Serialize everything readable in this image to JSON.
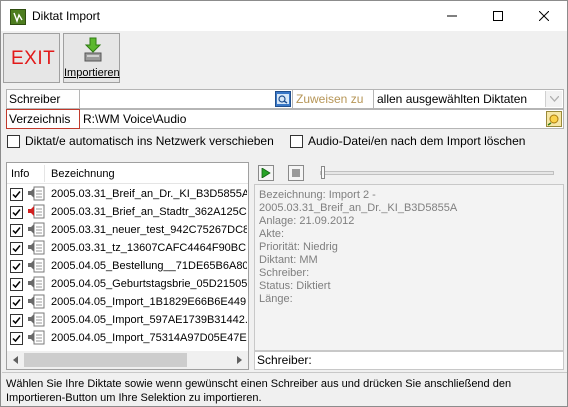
{
  "window": {
    "title": "Diktat Import",
    "icon": "app-logo-icon",
    "controls": [
      "minimize-icon",
      "maximize-icon",
      "close-icon"
    ]
  },
  "toolbar": {
    "exit_label": "EXIT",
    "import_label": "Importieren",
    "import_icon": "import-arrow-icon"
  },
  "form": {
    "schreiber_label": "Schreiber",
    "schreiber_value": "",
    "zuweisen_label": "Zuweisen zu",
    "assign_option": "allen ausgewählten Diktaten",
    "verzeichnis_label": "Verzeichnis",
    "verzeichnis_value": "R:\\WM Voice\\Audio"
  },
  "options": {
    "auto_network_label": "Diktat/e automatisch ins Netzwerk verschieben",
    "delete_audio_label": "Audio-Datei/en nach dem Import löschen"
  },
  "list": {
    "header_info": "Info",
    "header_name": "Bezeichnung",
    "rows": [
      {
        "name": "2005.03.31_Breif_an_Dr._KI_B3D5855A...",
        "checked": true,
        "icon": "document-speaker-icon"
      },
      {
        "name": "2005.03.31_Brief_an_Stadtr_362A125C...",
        "checked": true,
        "icon": "document-red-icon"
      },
      {
        "name": "2005.03.31_neuer_test_942C75267DC8...",
        "checked": true,
        "icon": "document-speaker-icon"
      },
      {
        "name": "2005.03.31_tz_13607CAFC4464F90BC...",
        "checked": true,
        "icon": "document-speaker-icon"
      },
      {
        "name": "2005.04.05_Bestellung__71DE65B6A80...",
        "checked": true,
        "icon": "document-speaker-icon"
      },
      {
        "name": "2005.04.05_Geburtstagsbrie_05D21505...",
        "checked": true,
        "icon": "document-speaker-icon"
      },
      {
        "name": "2005.04.05_Import_1B1829E66B6E449...",
        "checked": true,
        "icon": "document-speaker-icon"
      },
      {
        "name": "2005.04.05_Import_597AE1739B31442...",
        "checked": true,
        "icon": "document-speaker-icon"
      },
      {
        "name": "2005.04.05_Import_75314A97D05E47E...",
        "checked": true,
        "icon": "document-speaker-icon"
      }
    ]
  },
  "player": {
    "play_icon": "play-icon",
    "stop_icon": "stop-icon"
  },
  "details": {
    "lines": [
      "Bezeichnung: Import 2 -",
      "2005.03.31_Breif_an_Dr._KI_B3D5855A",
      "Anlage: 21.09.2012",
      "Akte:",
      "Priorität: Niedrig",
      "Diktant: MM",
      "Schreiber:",
      "Status: Diktiert",
      "Länge:"
    ],
    "footer_label": "Schreiber:"
  },
  "status": {
    "text": "Wählen Sie Ihre Diktate sowie wenn gewünscht einen Schreiber aus und drücken Sie anschließend den Importieren-Button um Ihre Selektion zu importieren."
  }
}
